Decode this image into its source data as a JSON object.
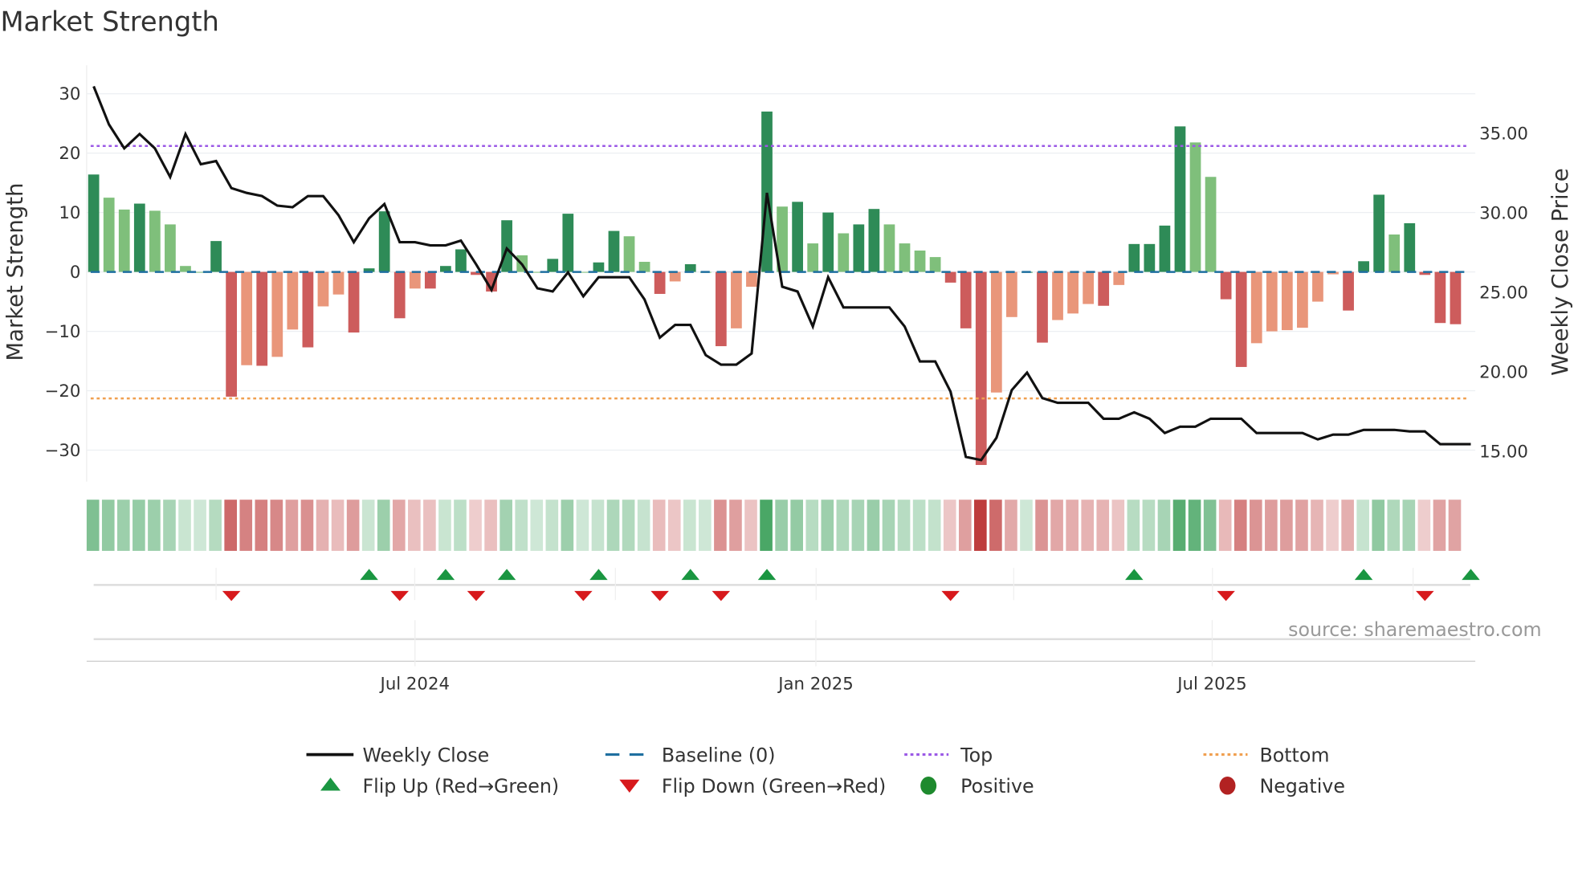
{
  "title": "Market Strength",
  "source": "source: sharemaestro.com",
  "colors": {
    "green_dark": "#2e8b57",
    "green_light": "#7fbf7b",
    "red_dark": "#cd5c5c",
    "red_light": "#e9967a",
    "top": "#9b59e6",
    "bottom": "#f0a050",
    "baseline": "#1f6fa0",
    "line": "#111111",
    "flip_up": "#1a9641",
    "flip_down": "#d7191c"
  },
  "chart_data": {
    "type": "bar",
    "title": "Market Strength",
    "ylabel": "Market Strength",
    "y2label": "Weekly Close Price",
    "ylim": [
      -35,
      35
    ],
    "y2lim": [
      13.5,
      38.3
    ],
    "yticks": [
      "30",
      "20",
      "10",
      "0",
      "−10",
      "−20",
      "−30"
    ],
    "ytick_values": [
      30,
      20,
      10,
      0,
      -10,
      -20,
      -30
    ],
    "y2ticks": [
      "35.00",
      "30.00",
      "25.00",
      "20.00",
      "15.00"
    ],
    "y2tick_values": [
      35,
      30,
      25,
      20,
      15
    ],
    "xticks": [
      {
        "label": "Jul 2024",
        "week": 21
      },
      {
        "label": "Jan 2025",
        "week": 47.2
      },
      {
        "label": "Jul 2025",
        "week": 73.1
      }
    ],
    "top": 21.2,
    "bottom": -21.3,
    "strength": [
      16.4,
      12.5,
      10.5,
      11.5,
      10.3,
      8,
      1,
      0,
      5.2,
      -21,
      -15.7,
      -15.8,
      -14.3,
      -9.7,
      -12.7,
      -5.8,
      -3.8,
      -10.2,
      0.6,
      10.2,
      -7.8,
      -2.8,
      -2.8,
      1,
      3.8,
      -0.5,
      -3.3,
      8.7,
      2.8,
      0,
      2.2,
      9.8,
      0,
      1.6,
      6.9,
      6,
      1.7,
      -3.7,
      -1.6,
      1.3,
      0,
      -12.5,
      -9.5,
      -2.5,
      27,
      11,
      11.8,
      4.8,
      10,
      6.5,
      8,
      10.6,
      8,
      4.8,
      3.6,
      2.5,
      -1.8,
      -9.5,
      -32.5,
      -20.3,
      -7.6,
      0,
      -11.9,
      -8.1,
      -7,
      -5.4,
      -5.7,
      -2.2,
      4.7,
      4.7,
      7.8,
      24.5,
      21.8,
      16,
      -4.6,
      -16,
      -12,
      -10,
      -9.8,
      -9.4,
      -5,
      -0.4,
      -6.5,
      1.8,
      13,
      6.3,
      8.2,
      -0.5,
      -8.6,
      -8.8
    ],
    "weekly_close": [
      37.9,
      35.5,
      34.0,
      34.9,
      34.0,
      32.2,
      34.9,
      33.0,
      33.2,
      31.5,
      31.2,
      31.0,
      30.4,
      30.3,
      31.0,
      31.0,
      29.8,
      28.1,
      29.6,
      30.5,
      28.1,
      28.1,
      27.9,
      27.9,
      28.2,
      26.7,
      25.1,
      27.7,
      26.7,
      25.2,
      25.0,
      26.2,
      24.7,
      25.9,
      25.9,
      25.9,
      24.5,
      22.1,
      22.9,
      22.9,
      21.0,
      20.4,
      20.4,
      21.1,
      31.2,
      25.3,
      25.0,
      22.8,
      25.9,
      24.0,
      24.0,
      24.0,
      24.0,
      22.8,
      20.6,
      20.6,
      18.7,
      14.6,
      14.4,
      15.8,
      18.8,
      19.9,
      18.3,
      18.0,
      18.0,
      18.0,
      17.0,
      17.0,
      17.4,
      17.0,
      16.1,
      16.5,
      16.5,
      17.0,
      17.0,
      17.0,
      16.1,
      16.1,
      16.1,
      16.1,
      15.7,
      16.0,
      16.0,
      16.3,
      16.3,
      16.3,
      16.2,
      16.2,
      15.4,
      15.4,
      15.4
    ],
    "flip_up_weeks": [
      18,
      23,
      27,
      33,
      39,
      44,
      68,
      83,
      90
    ],
    "flip_down_weeks": [
      9,
      20,
      25,
      32,
      37,
      41,
      56,
      74,
      87
    ]
  },
  "legend": [
    {
      "label": "Weekly Close",
      "kind": "line"
    },
    {
      "label": "Baseline (0)",
      "kind": "dash"
    },
    {
      "label": "Top",
      "kind": "dot-top"
    },
    {
      "label": "Bottom",
      "kind": "dot-bottom"
    },
    {
      "label": "Flip Up (Red→Green)",
      "kind": "up"
    },
    {
      "label": "Flip Down (Green→Red)",
      "kind": "down"
    },
    {
      "label": "Positive",
      "kind": "pos"
    },
    {
      "label": "Negative",
      "kind": "neg"
    }
  ]
}
